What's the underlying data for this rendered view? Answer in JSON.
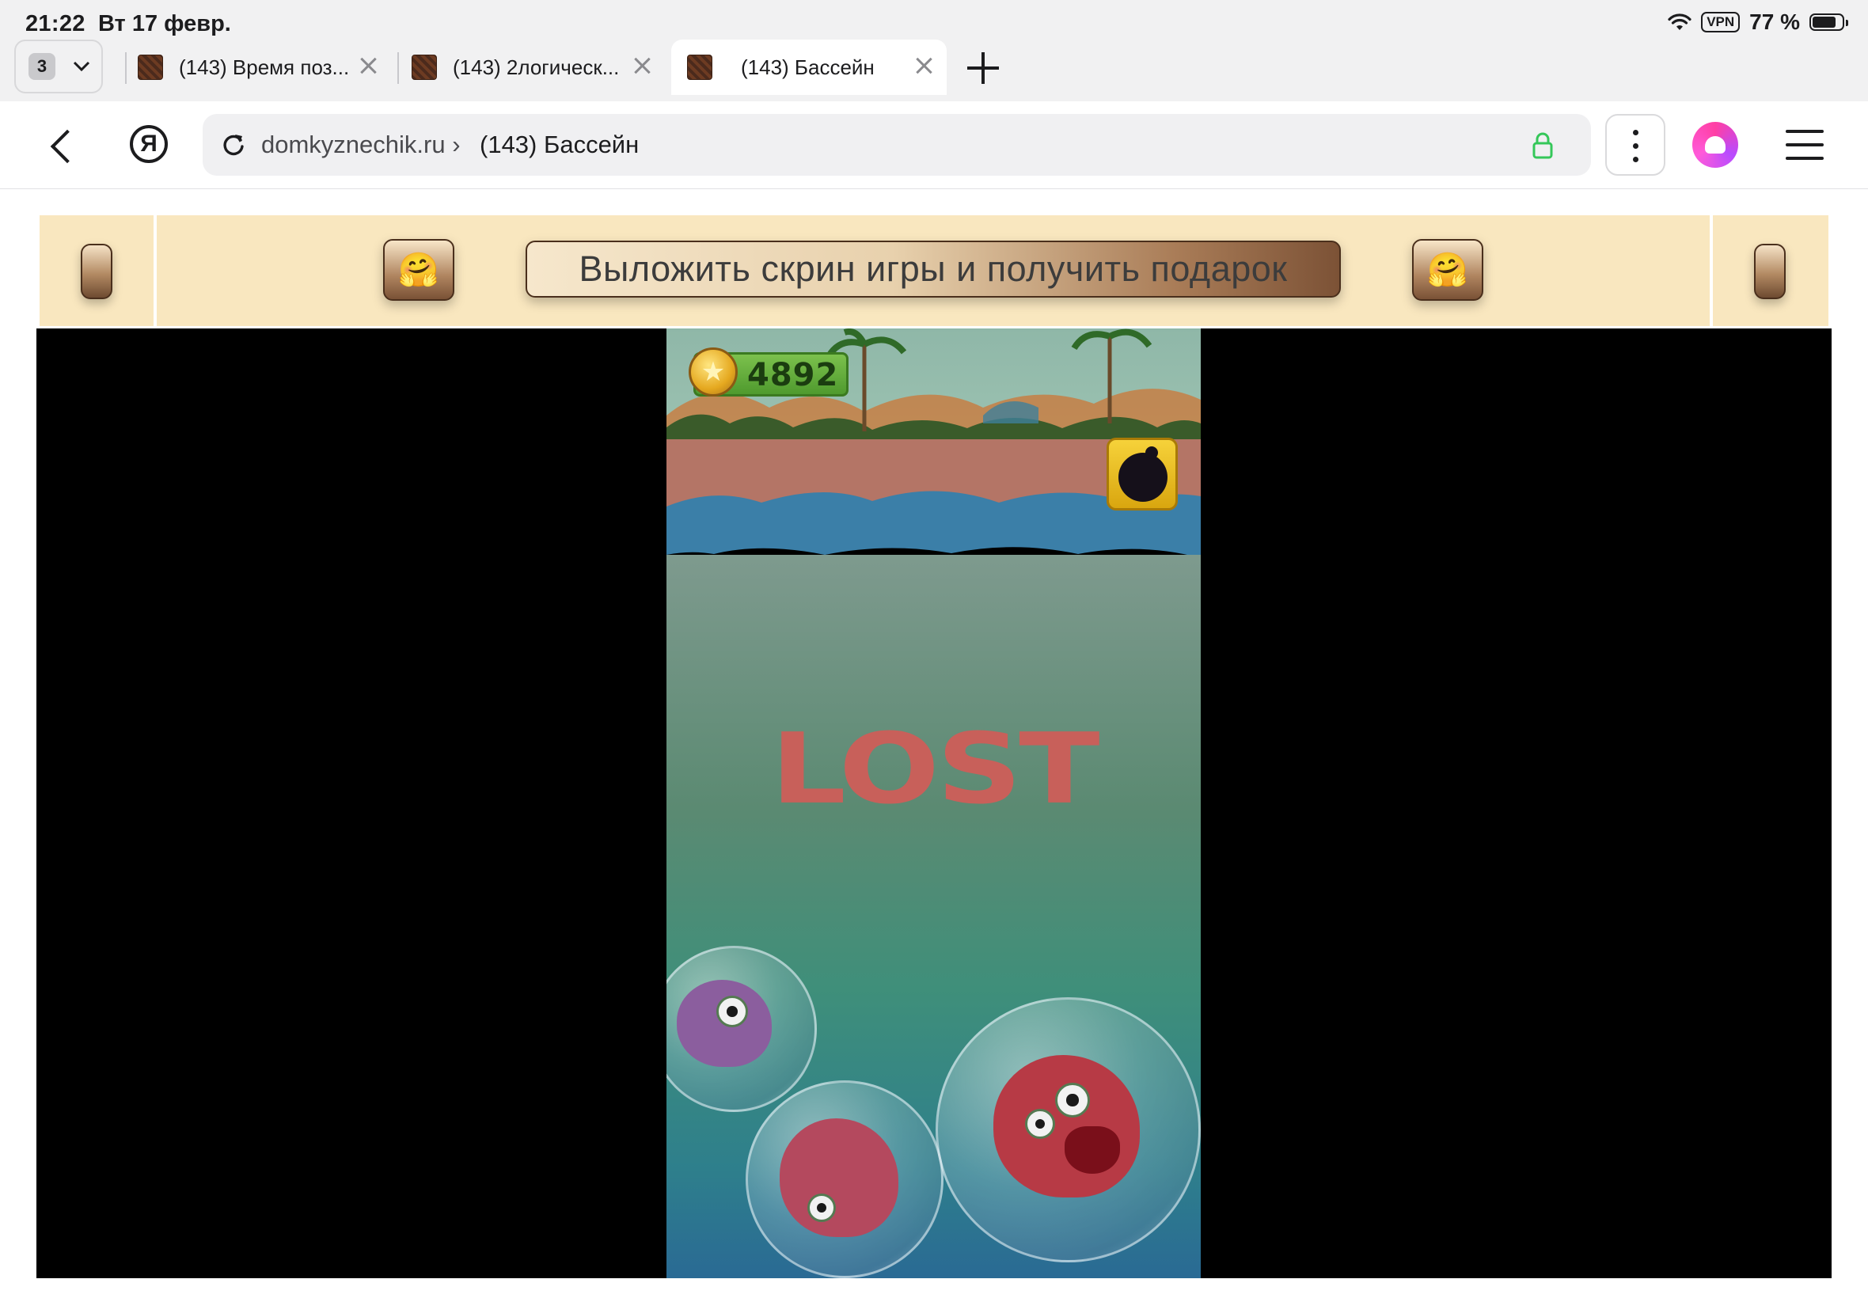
{
  "status_bar": {
    "time": "21:22",
    "date": "Вт 17 февр.",
    "vpn": "VPN",
    "battery": "77 %",
    "battery_level": 0.77
  },
  "tabs": {
    "count": "3",
    "items": [
      {
        "title": "(143) Время поз...",
        "active": false
      },
      {
        "title": "(143) 2логическ...",
        "active": false
      },
      {
        "title": "(143) Бассейн",
        "active": true
      }
    ]
  },
  "address_bar": {
    "domain": "domkyznechik.ru",
    "separator": "›",
    "page_title": "(143) Бассейн",
    "secure_color": "#34c759"
  },
  "banner": {
    "cta_label": "Выложить скрин игры и получить подарок",
    "emoji_left": "🤗",
    "emoji_right": "🤗"
  },
  "game": {
    "coins": "4892",
    "status_text": "LOST",
    "power_up": "bomb-icon"
  },
  "colors": {
    "banner_bg": "#f9e7bf",
    "lost_text": "#c8605a",
    "coin_bar": "#5aa534"
  }
}
